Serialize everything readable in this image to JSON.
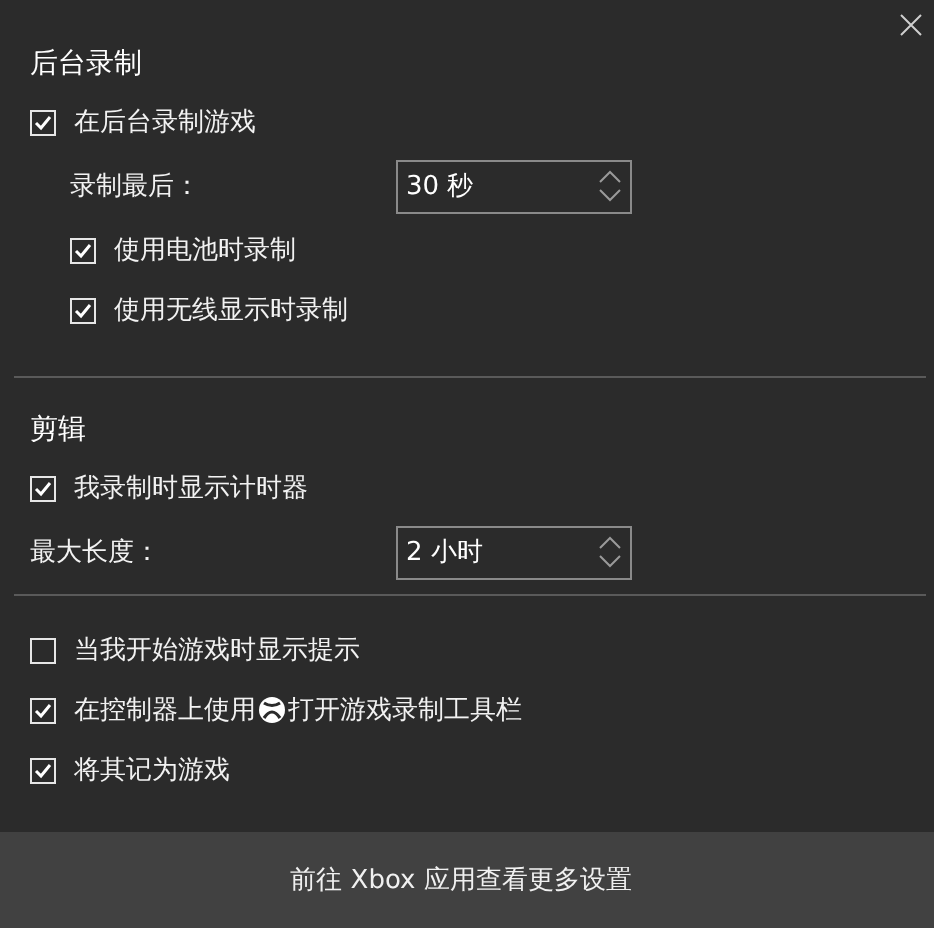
{
  "sections": [
    {
      "title": "后台录制",
      "items": [
        {
          "kind": "checkbox",
          "label": "在后台录制游戏",
          "checked": true,
          "indented": false
        },
        {
          "kind": "spinner",
          "label": "录制最后：",
          "value": "30 秒",
          "indented": true
        },
        {
          "kind": "checkbox",
          "label": "使用电池时录制",
          "checked": true,
          "indented": true
        },
        {
          "kind": "checkbox",
          "label": "使用无线显示时录制",
          "checked": true,
          "indented": true
        }
      ]
    },
    {
      "title": "剪辑",
      "items": [
        {
          "kind": "checkbox",
          "label": "我录制时显示计时器",
          "checked": true,
          "indented": false
        },
        {
          "kind": "spinner",
          "label": "最大长度：",
          "value": "2 小时",
          "indented": false
        }
      ]
    },
    {
      "items": [
        {
          "kind": "checkbox",
          "label": "当我开始游戏时显示提示",
          "checked": false,
          "indented": false
        },
        {
          "kind": "checkbox",
          "label": "在控制器上使用",
          "label_after": "打开游戏录制工具栏",
          "checked": true,
          "indented": false
        },
        {
          "kind": "checkbox",
          "label": "将其记为游戏",
          "checked": true,
          "indented": false
        }
      ]
    }
  ],
  "footer": {
    "link": "前往 Xbox 应用查看更多设置"
  }
}
